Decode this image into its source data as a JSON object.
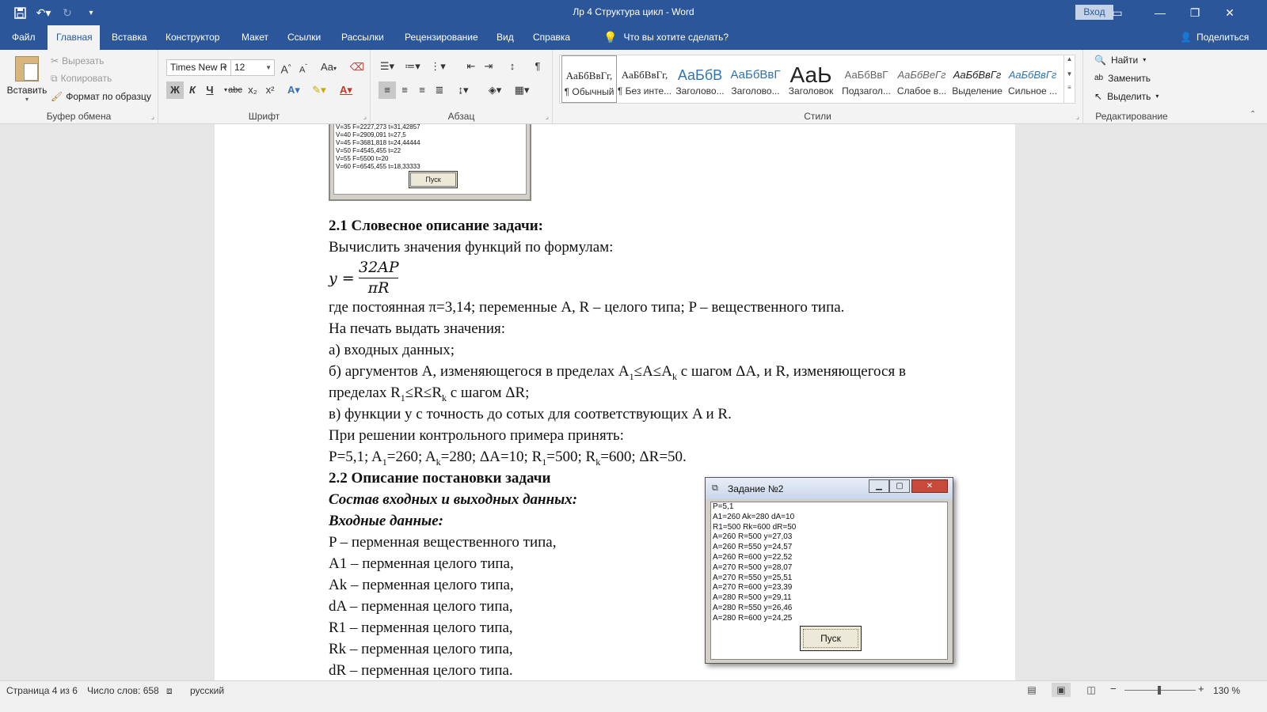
{
  "titlebar": {
    "doc_title": "Лр 4 Структура цикл  -  Word",
    "signin_label": "Вход",
    "qat": {
      "save_icon": "save-icon",
      "undo_icon": "undo-icon",
      "redo_icon": "redo-icon",
      "customize_icon": "customize-qat-icon"
    }
  },
  "tabs": [
    {
      "label": "Файл"
    },
    {
      "label": "Главная"
    },
    {
      "label": "Вставка"
    },
    {
      "label": "Конструктор"
    },
    {
      "label": "Макет"
    },
    {
      "label": "Ссылки"
    },
    {
      "label": "Рассылки"
    },
    {
      "label": "Рецензирование"
    },
    {
      "label": "Вид"
    },
    {
      "label": "Справка"
    }
  ],
  "tell_me": "Что вы хотите сделать?",
  "share_label": "Поделиться",
  "ribbon": {
    "clipboard": {
      "label": "Буфер обмена",
      "paste": "Вставить",
      "cut": "Вырезать",
      "copy": "Копировать",
      "format_painter": "Формат по образцу"
    },
    "font": {
      "label": "Шрифт",
      "font_name": "Times New R",
      "font_size": "12",
      "bold": "Ж",
      "italic": "К",
      "underline": "Ч",
      "strike": "abc",
      "subscript": "x₂",
      "superscript": "x²",
      "grow": "A",
      "shrink": "A",
      "case": "Aa"
    },
    "paragraph": {
      "label": "Абзац"
    },
    "styles": {
      "label": "Стили",
      "items": [
        {
          "preview": "АаБбВвГг,",
          "name": "¶ Обычный"
        },
        {
          "preview": "АаБбВвГг,",
          "name": "¶ Без инте..."
        },
        {
          "preview": "АаБбВ",
          "name": "Заголово..."
        },
        {
          "preview": "АаБбВвГ",
          "name": "Заголово..."
        },
        {
          "preview": "АаЬ",
          "name": "Заголовок"
        },
        {
          "preview": "АаБбВвГ",
          "name": "Подзагол..."
        },
        {
          "preview": "АаБбВеГг",
          "name": "Слабое в..."
        },
        {
          "preview": "АаБбВвГг",
          "name": "Выделение"
        },
        {
          "preview": "АаБбВвГг",
          "name": "Сильное ..."
        }
      ]
    },
    "editing": {
      "label": "Редактирование",
      "find": "Найти",
      "replace": "Заменить",
      "select": "Выделить"
    }
  },
  "mini_window": {
    "lines": [
      "V=35 F=2227,273 t=31,42857",
      "V=40 F=2909,091 t=27,5",
      "V=45 F=3681,818 t=24,44444",
      "V=50 F=4545,455 t=22",
      "V=55 F=5500 t=20",
      "V=60 F=6545,455 t=18,33333"
    ],
    "button": "Пуск"
  },
  "document": {
    "h21": "2.1 Словесное описание задачи:",
    "p1": "Вычислить значения функций по формулам:",
    "formula": {
      "lhs": "y =",
      "num": "32AP",
      "den": "πR"
    },
    "p2": "где постоянная π=3,14; переменные A, R – целого типа; P – вещественного типа.",
    "p3": "На печать выдать значения:",
    "p4": "а) входных данных;",
    "p5a": "б) аргументов A, изменяющегося в пределах A",
    "p5_sub1": "1",
    "p5b": "≤A≤A",
    "p5_subk": "k",
    "p5c": " с шагом ΔA, и R, изменяющегося в",
    "p6a": "пределах R",
    "p6_sub1": "1",
    "p6b": "≤R≤R",
    "p6_subk": "k",
    "p6c": " с шагом ΔR;",
    "p7": "в) функции y с точность до сотых для соответствующих A и R.",
    "p8": "При решении контрольного примера принять:",
    "p9": {
      "a": "P=5,1; A",
      "s1": "1",
      "b": "=260; A",
      "s2": "k",
      "c": "=280; ΔA=10; R",
      "s3": "1",
      "d": "=500; R",
      "s4": "k",
      "e": "=600; ΔR=50."
    },
    "h22": "2.2  Описание постановки задачи",
    "h_io": "Состав входных и выходных данных:",
    "h_in": "Входные данные:",
    "vars": [
      "P – перменная вещественного типа,",
      "A1 – перменная целого типа,",
      "Ak – перменная целого типа,",
      "dA – перменная целого типа,",
      "R1 – перменная целого типа,",
      "Rk – перменная целого типа,",
      "dR – перменная целого типа."
    ]
  },
  "dialog": {
    "title": "Задание №2",
    "lines": [
      "P=5,1",
      "A1=260 Ak=280 dA=10",
      "R1=500 Rk=600 dR=50",
      "A=260 R=500 y=27,03",
      "A=260 R=550 y=24,57",
      "A=260 R=600 y=22,52",
      "A=270 R=500 y=28,07",
      "A=270 R=550 y=25,51",
      "A=270 R=600 y=23,39",
      "A=280 R=500 y=29,11",
      "A=280 R=550 y=26,46",
      "A=280 R=600 y=24,25"
    ],
    "button": "Пуск"
  },
  "status": {
    "page": "Страница 4 из 6",
    "words": "Число слов: 658",
    "language": "русский",
    "zoom": "130 %"
  }
}
